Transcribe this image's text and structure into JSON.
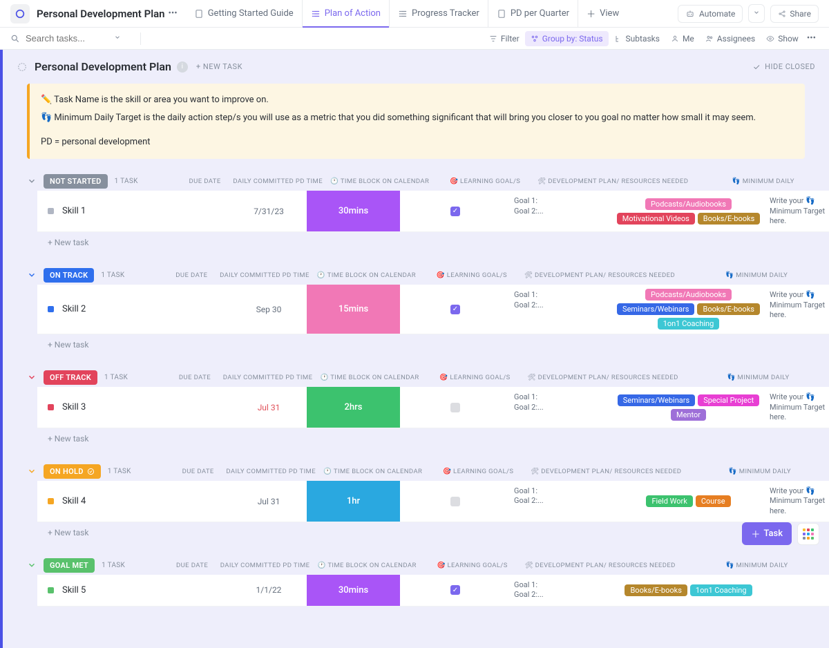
{
  "header": {
    "title": "Personal Development Plan",
    "tabs": [
      {
        "label": "Getting Started Guide"
      },
      {
        "label": "Plan of Action"
      },
      {
        "label": "Progress Tracker"
      },
      {
        "label": "PD per Quarter"
      },
      {
        "label": "View"
      }
    ],
    "automate": "Automate",
    "share": "Share"
  },
  "toolbar": {
    "search_placeholder": "Search tasks...",
    "filter": "Filter",
    "group_by": "Group by: Status",
    "subtasks": "Subtasks",
    "me": "Me",
    "assignees": "Assignees",
    "show": "Show"
  },
  "plan": {
    "title": "Personal Development Plan",
    "new_task": "+ NEW TASK",
    "hide_closed": "HIDE CLOSED"
  },
  "note": {
    "line1": "✏️ Task Name is the skill or area you want to improve on.",
    "line2": "👣 Minimum Daily Target is the daily action step/s you will use as a metric that you did something significant that will bring you closer to you goal no matter how small it may seem.",
    "line3": "PD = personal development"
  },
  "columns": {
    "due": "DUE DATE",
    "time": "DAILY COMMITTED PD TIME",
    "cal": "🕐 TIME BLOCK ON CALENDAR",
    "goal": "🎯 LEARNING GOAL/S",
    "plan": "🛠 DEVELOPMENT PLAN/ RESOURCES NEEDED",
    "min": "👣 MINIMUM DAILY"
  },
  "new_task_row": "+ New task",
  "tags": {
    "podcasts": {
      "label": "Podcasts/Audiobooks",
      "bg": "#f178b6"
    },
    "motivational": {
      "label": "Motivational Videos",
      "bg": "#e2445c"
    },
    "books": {
      "label": "Books/E-books",
      "bg": "#b5872c"
    },
    "seminars": {
      "label": "Seminars/Webinars",
      "bg": "#3668e6"
    },
    "coaching": {
      "label": "1on1 Coaching",
      "bg": "#3dc7d4"
    },
    "special": {
      "label": "Special Project",
      "bg": "#e83fd3"
    },
    "mentor": {
      "label": "Mentor",
      "bg": "#9e6fd8"
    },
    "fieldwork": {
      "label": "Field Work",
      "bg": "#3cc26e"
    },
    "course": {
      "label": "Course",
      "bg": "#e67e22"
    }
  },
  "groups": [
    {
      "status": "NOT STARTED",
      "status_bg": "#87909e",
      "chev_color": "#87909e",
      "count": "1 TASK",
      "tasks": [
        {
          "name": "Skill 1",
          "sq": "#b0b6c3",
          "due": "7/31/23",
          "overdue": false,
          "time": "30mins",
          "time_bg": "#a955f7",
          "cal": true,
          "goals": [
            "Goal 1:",
            "Goal 2:..."
          ],
          "tags": [
            "podcasts",
            "motivational",
            "books"
          ],
          "min": "Write your 👣 Minimum Target here."
        }
      ]
    },
    {
      "status": "ON TRACK",
      "status_bg": "#2f6fed",
      "chev_color": "#2f6fed",
      "count": "1 TASK",
      "tasks": [
        {
          "name": "Skill 2",
          "sq": "#2f6fed",
          "due": "Sep 30",
          "overdue": false,
          "time": "15mins",
          "time_bg": "#f178b6",
          "cal": true,
          "goals": [
            "Goal 1:",
            "Goal 2:..."
          ],
          "tags": [
            "podcasts",
            "seminars",
            "books",
            "coaching"
          ],
          "min": "Write your 👣 Minimum Target here."
        }
      ]
    },
    {
      "status": "OFF TRACK",
      "status_bg": "#e2445c",
      "chev_color": "#e2445c",
      "count": "1 TASK",
      "tasks": [
        {
          "name": "Skill 3",
          "sq": "#e2445c",
          "due": "Jul 31",
          "overdue": true,
          "time": "2hrs",
          "time_bg": "#3cc26e",
          "cal": false,
          "goals": [
            "Goal 1:",
            "Goal 2:..."
          ],
          "tags": [
            "seminars",
            "special",
            "mentor"
          ],
          "min": "Write your 👣 Minimum Target here."
        }
      ]
    },
    {
      "status": "ON HOLD",
      "status_bg": "#f5a623",
      "has_check": true,
      "chev_color": "#f5a623",
      "count": "1 TASK",
      "tasks": [
        {
          "name": "Skill 4",
          "sq": "#f5a623",
          "due": "Jul 31",
          "overdue": false,
          "time": "1hr",
          "time_bg": "#2aa8e0",
          "cal": false,
          "goals": [
            "Goal 1:",
            "Goal 2:..."
          ],
          "tags": [
            "fieldwork",
            "course"
          ],
          "min": "Write your 👣 Minimum Target here."
        }
      ]
    },
    {
      "status": "GOAL MET",
      "status_bg": "#59c16c",
      "chev_color": "#59c16c",
      "count": "1 TASK",
      "no_newtask": true,
      "tasks": [
        {
          "name": "Skill 5",
          "sq": "#59c16c",
          "due": "1/1/22",
          "overdue": false,
          "time": "30mins",
          "time_bg": "#a955f7",
          "cal": true,
          "goals": [
            "Goal 1:",
            "Goal 2:..."
          ],
          "tags": [
            "books",
            "coaching"
          ],
          "min": ""
        }
      ]
    }
  ],
  "fab": {
    "task": "Task"
  }
}
